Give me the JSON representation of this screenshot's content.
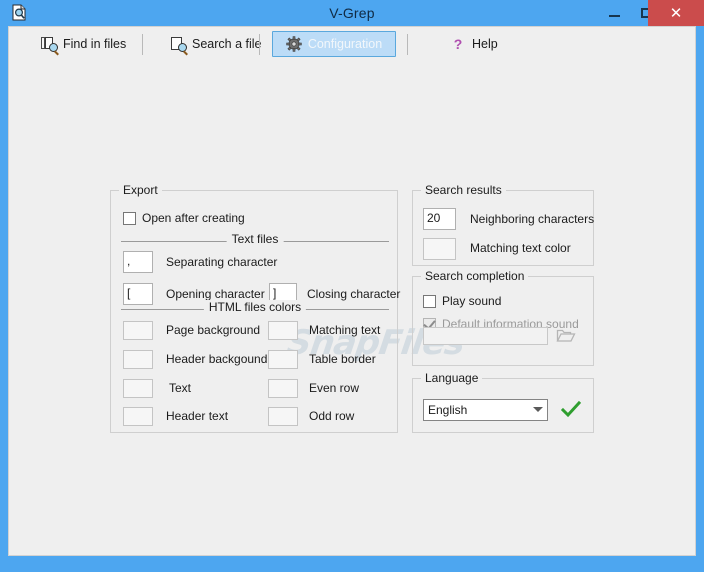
{
  "window": {
    "title": "V-Grep",
    "app_icon": "document-search-icon",
    "controls": {
      "minimize": "minimize-icon",
      "maximize": "maximize-icon",
      "close": "✕"
    },
    "accent_titlebar": "#4da6f0",
    "close_button_color": "#cb4c4c"
  },
  "toolbar": {
    "items": [
      {
        "label": "Find in files",
        "icon": "find-in-files-icon",
        "selected": false
      },
      {
        "label": "Search a file",
        "icon": "search-file-icon",
        "selected": false
      },
      {
        "label": "Configuration",
        "icon": "gear-icon",
        "selected": true
      },
      {
        "label": "Help",
        "icon": "question-mark-icon",
        "selected": false
      }
    ]
  },
  "export": {
    "title": "Export",
    "open_after_creating": {
      "label": "Open after creating",
      "checked": false
    },
    "text_files_caption": "Text files",
    "separating_character": {
      "value": ",",
      "label": "Separating character"
    },
    "opening_character": {
      "value": "[",
      "label": "Opening character"
    },
    "closing_character": {
      "value": "]",
      "label": "Closing character"
    },
    "html_colors_caption": "HTML files colors",
    "color_fields": [
      {
        "label": "Page background",
        "value": ""
      },
      {
        "label": "Header backgound",
        "value": ""
      },
      {
        "label": "Text",
        "value": ""
      },
      {
        "label": "Header text",
        "value": ""
      },
      {
        "label": "Matching text",
        "value": ""
      },
      {
        "label": "Table border",
        "value": ""
      },
      {
        "label": "Even row",
        "value": ""
      },
      {
        "label": "Odd row",
        "value": ""
      }
    ]
  },
  "search_results": {
    "title": "Search results",
    "neighboring_characters": {
      "value": "20",
      "label": "Neighboring characters"
    },
    "matching_text_color": {
      "label": "Matching text color",
      "value": ""
    }
  },
  "search_completion": {
    "title": "Search completion",
    "play_sound": {
      "label": "Play sound",
      "checked": false
    },
    "default_information_sound": {
      "label": "Default information sound",
      "checked": true,
      "disabled": true
    },
    "sound_path": {
      "value": "",
      "browse_icon": "folder-open-icon"
    }
  },
  "language": {
    "title": "Language",
    "selected": "English",
    "options": [
      "English"
    ],
    "confirm_icon": "green-check-icon"
  },
  "watermark": {
    "text": "SnapFiles"
  }
}
